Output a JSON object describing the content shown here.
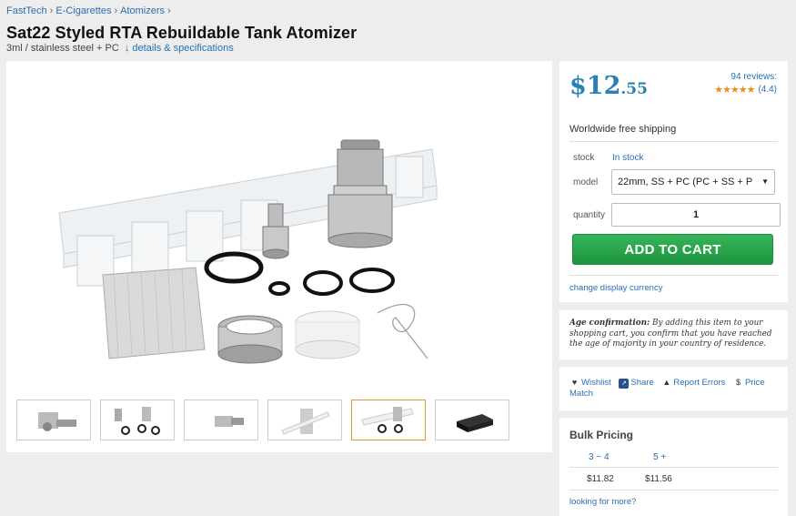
{
  "breadcrumb": [
    "FastTech",
    "E-Cigarettes",
    "Atomizers"
  ],
  "breadcrumb_separator": "›",
  "product": {
    "title": "Sat22 Styled RTA Rebuildable Tank Atomizer",
    "subtitle": "3ml / stainless steel + PC",
    "details_link": "↓ details & specifications"
  },
  "gallery": {
    "thumbnail_count": 6,
    "active_thumbnail": 5
  },
  "buy_box": {
    "price_dollars": "$12",
    "price_cents": ".55",
    "reviews_count": "94 reviews:",
    "stars": "★★★★★",
    "rating": "(4.4)",
    "shipping": "Worldwide free shipping",
    "stock_label": "stock",
    "stock_value": "In stock",
    "model_label": "model",
    "model_value": "22mm, SS + PC (PC + SS + P",
    "quantity_label": "quantity",
    "quantity_value": "1",
    "add_to_cart": "ADD TO CART",
    "change_currency": "change display currency"
  },
  "age_confirmation": {
    "heading": "Age confirmation:",
    "text": "By adding this item to your shopping cart, you confirm that you have reached the age of majority in your country of residence."
  },
  "actions": {
    "wishlist": "Wishlist",
    "share": "Share",
    "report": "Report Errors",
    "price_match": "Price Match"
  },
  "bulk": {
    "title": "Bulk Pricing",
    "tiers": [
      {
        "qty": "3 ~ 4",
        "price": "$11.82"
      },
      {
        "qty": "5 +",
        "price": "$11.56"
      }
    ],
    "more": "looking for more?"
  },
  "colors": {
    "link": "#2a6fb0",
    "price": "#2a7fb3",
    "cart_button": "#27a34a",
    "stars": "#e8901d"
  }
}
